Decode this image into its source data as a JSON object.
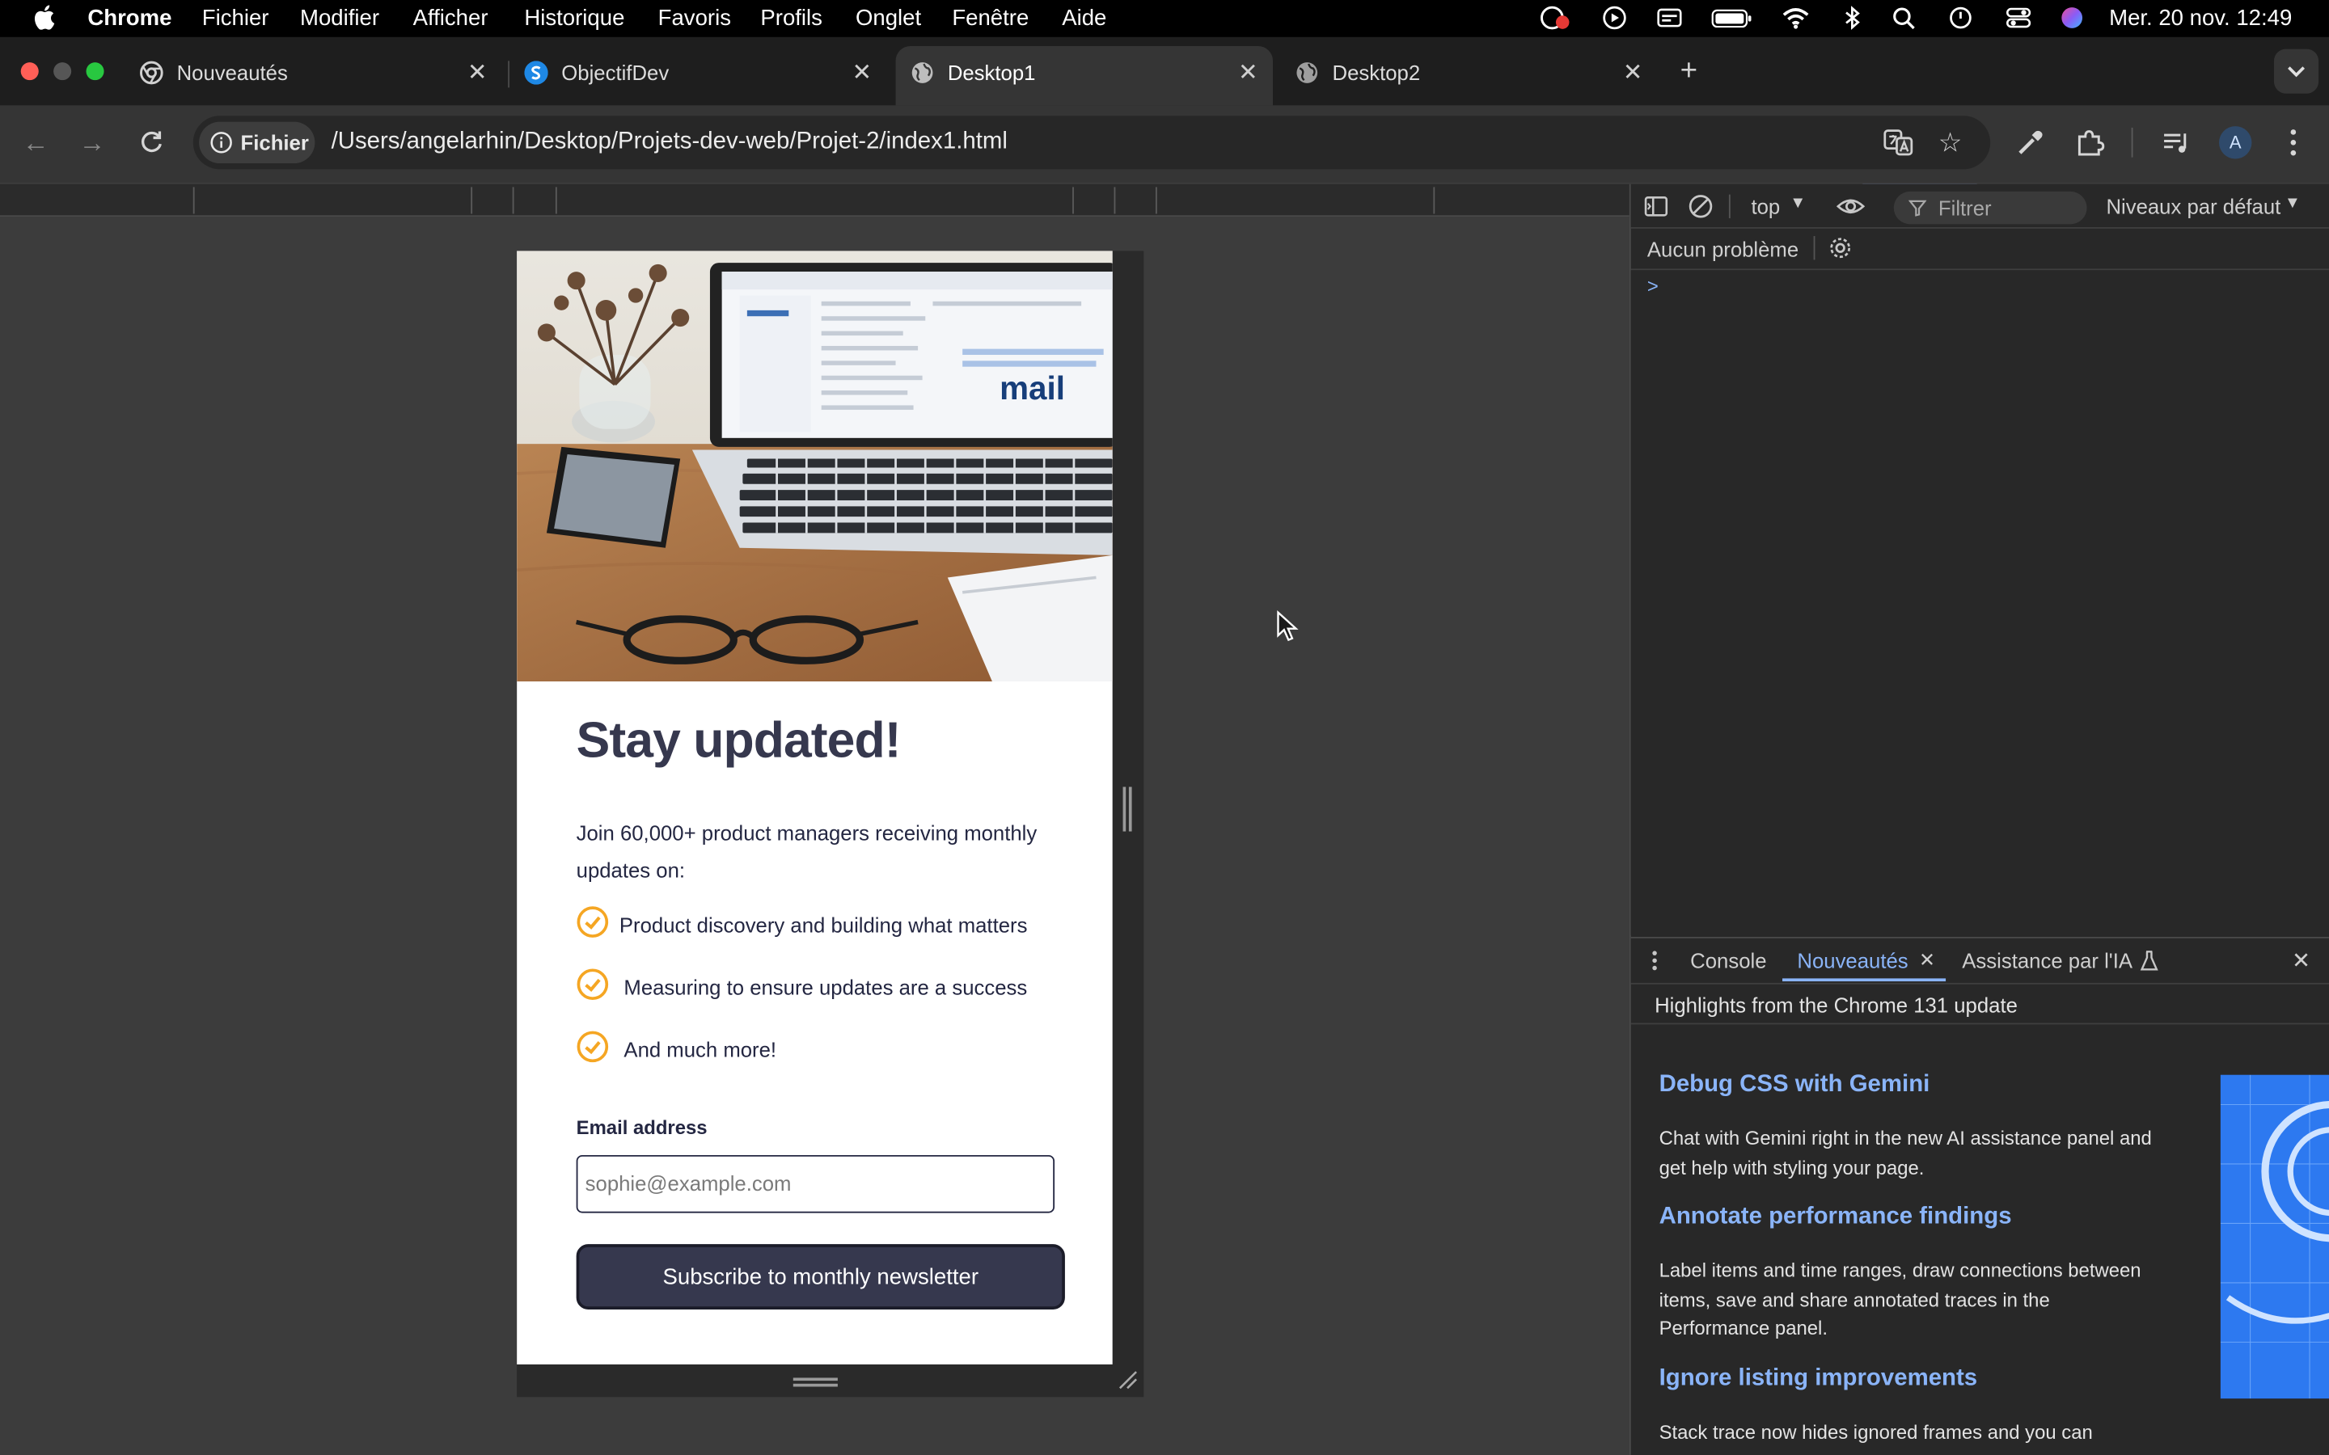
{
  "menubar": {
    "app": "Chrome",
    "items": [
      "Fichier",
      "Modifier",
      "Afficher",
      "Historique",
      "Favoris",
      "Profils",
      "Onglet",
      "Fenêtre",
      "Aide"
    ],
    "datetime": "Mer. 20 nov.  12:49"
  },
  "tabs": [
    {
      "label": "Nouveautés",
      "icon": "chrome-icon",
      "active": false
    },
    {
      "label": "ObjectifDev",
      "icon": "s-logo-icon",
      "active": false
    },
    {
      "label": "Desktop1",
      "icon": "globe-icon",
      "active": true
    },
    {
      "label": "Desktop2",
      "icon": "globe-icon",
      "active": false
    }
  ],
  "addressbar": {
    "chip": "Fichier",
    "url": "/Users/angelarhin/Desktop/Projets-dev-web/Projet-2/index1.html",
    "profile_initial": "A"
  },
  "page": {
    "title": "Stay updated!",
    "intro": "Join 60,000+ product managers receiving monthly updates on:",
    "bullets": [
      "Product discovery and building what matters",
      "Measuring to ensure updates are a success",
      "And much more!"
    ],
    "email_label": "Email address",
    "email_placeholder": "sophie@example.com",
    "subscribe_label": "Subscribe to monthly newsletter",
    "hero_screen_text": "mail"
  },
  "devtools": {
    "context": "top",
    "filter_placeholder": "Filtrer",
    "levels": "Niveaux par défaut",
    "issues": "Aucun problème",
    "console_prompt": ">",
    "drawer_tabs": [
      "Console",
      "Nouveautés",
      "Assistance par l'IA"
    ],
    "whatsnew_header": "Highlights from the Chrome 131 update",
    "articles": [
      {
        "title": "Debug CSS with Gemini",
        "body": "Chat with Gemini right in the new AI assistance panel and get help with styling your page."
      },
      {
        "title": "Annotate performance findings",
        "body": "Label items and time ranges, draw connections between items, save and share annotated traces in the Performance panel."
      },
      {
        "title": "Ignore listing improvements",
        "body": "Stack trace now hides ignored frames and you can"
      }
    ]
  },
  "colors": {
    "accent_blue": "#8ab4f8",
    "card_dark": "#36384e",
    "check_orange": "#f5a623"
  }
}
